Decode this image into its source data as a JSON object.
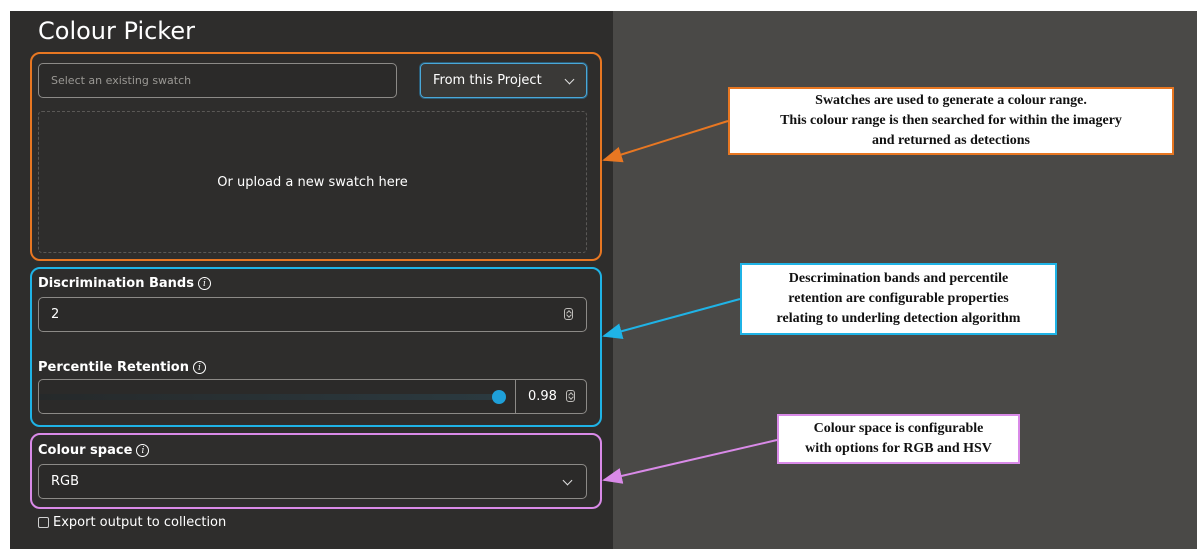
{
  "panel": {
    "title": "Colour Picker",
    "swatch_placeholder": "Select an existing swatch",
    "swatch_source": "From this Project",
    "upload_text": "Or upload a new swatch here",
    "discrimination_label": "Discrimination Bands",
    "discrimination_value": "2",
    "percentile_label": "Percentile Retention",
    "percentile_value": "0.98",
    "colour_space_label": "Colour space",
    "colour_space_value": "RGB",
    "export_label": "Export output to collection",
    "info_glyph": "i"
  },
  "annotations": {
    "swatches": [
      "Swatches are used to generate a colour range.",
      "This colour range is then searched for within the imagery",
      "and returned as detections"
    ],
    "bands": [
      "Descrimination bands and percentile",
      "retention are configurable properties",
      "relating to underling detection algorithm"
    ],
    "colour_space": [
      "Colour space is configurable",
      "with options for RGB and HSV"
    ]
  },
  "colors": {
    "orange": "#e87722",
    "blue": "#1fb3e6",
    "purple": "#d98ae8",
    "slider_thumb": "#1fa0d9"
  }
}
